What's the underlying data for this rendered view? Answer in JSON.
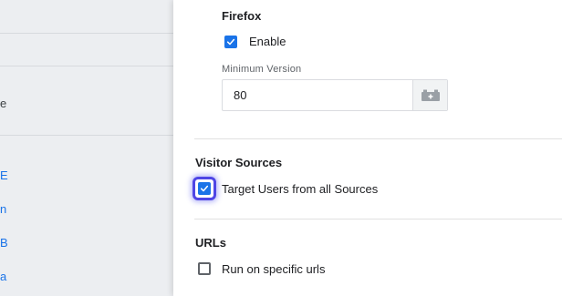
{
  "background": {
    "fragments": [
      {
        "text": "e",
        "style": "text"
      },
      {
        "text": "E",
        "style": "link"
      },
      {
        "text": "n",
        "style": "link"
      },
      {
        "text": "B",
        "style": "link"
      },
      {
        "text": "a",
        "style": "link"
      }
    ]
  },
  "firefox": {
    "title": "Firefox",
    "enable_label": "Enable",
    "enable_checked": true,
    "min_version_label": "Minimum Version",
    "min_version_value": "80",
    "addon_icon": "plugin-icon"
  },
  "visitor_sources": {
    "title": "Visitor Sources",
    "target_all_label": "Target Users from all Sources",
    "target_all_checked": true
  },
  "urls": {
    "title": "URLs",
    "run_specific_label": "Run on specific urls",
    "run_specific_checked": false
  },
  "colors": {
    "accent": "#1a73e8",
    "focus_ring": "#4f46e5"
  }
}
